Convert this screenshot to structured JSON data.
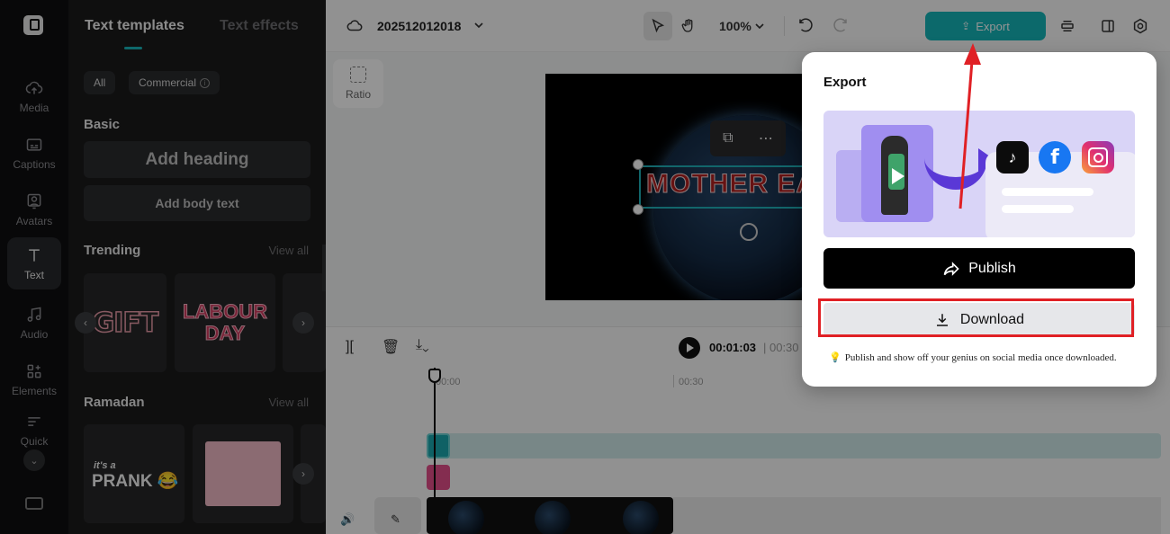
{
  "rail": {
    "items": [
      {
        "label": "Media",
        "icon": "cloud-upload-icon"
      },
      {
        "label": "Captions",
        "icon": "captions-icon"
      },
      {
        "label": "Avatars",
        "icon": "avatar-icon"
      },
      {
        "label": "Text",
        "icon": "text-icon"
      },
      {
        "label": "Audio",
        "icon": "music-note-icon"
      },
      {
        "label": "Elements",
        "icon": "elements-icon"
      },
      {
        "label": "Quick",
        "icon": "quick-icon"
      }
    ]
  },
  "panel": {
    "tabs": [
      "Text templates",
      "Text effects"
    ],
    "filters": [
      "All",
      "Commercial"
    ],
    "basic_title": "Basic",
    "add_heading": "Add heading",
    "add_body": "Add body text",
    "trending_title": "Trending",
    "trending_view_all": "View all",
    "trending_thumbs": [
      "GIFT",
      "LABOUR DAY"
    ],
    "ramadan_title": "Ramadan",
    "ramadan_view_all": "View all",
    "ramadan_thumb_small": "it's a",
    "ramadan_thumb_big": "PRANK 😂"
  },
  "topbar": {
    "project_name": "202512012018",
    "zoom": "100%",
    "export_label": "Export"
  },
  "stage": {
    "ratio_label": "Ratio",
    "canvas_text": "MOTHER EARTH"
  },
  "timeline": {
    "current_time": "00:01:03",
    "total_time": "| 00:30",
    "ruler": [
      "00:00",
      "00:30"
    ]
  },
  "export_popover": {
    "title": "Export",
    "publish_label": "Publish",
    "download_label": "Download",
    "hint": "Publish and show off your genius on social media once downloaded.",
    "hint_icon": "💡",
    "social": [
      "tiktok",
      "facebook",
      "instagram"
    ]
  },
  "colors": {
    "accent": "#15b6b8",
    "annotation_red": "#e02025"
  }
}
